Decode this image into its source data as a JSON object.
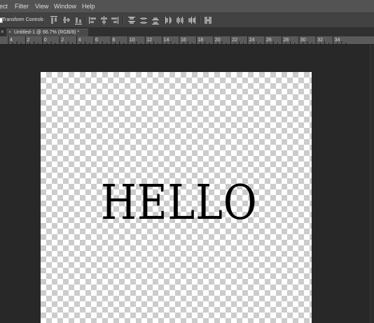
{
  "menu": [
    "ect",
    "Filter",
    "View",
    "Window",
    "Help"
  ],
  "options_bar": {
    "transform_controls_label": "Transform Controls",
    "transform_controls_checked": true
  },
  "document_tab": {
    "close_glyph": "×",
    "title": "Untitled-1 @ 66.7% (RGB/8) *"
  },
  "panel_close_glyph": "×",
  "ruler": {
    "labels": [
      "4",
      "2",
      "0",
      "2",
      "4",
      "6",
      "8",
      "10",
      "12",
      "14",
      "16",
      "18",
      "20",
      "22",
      "24",
      "26",
      "28",
      "30",
      "32",
      "34"
    ]
  },
  "canvas": {
    "text": "HELLO",
    "text_color": "#000000",
    "background": "transparent-checkerboard"
  }
}
